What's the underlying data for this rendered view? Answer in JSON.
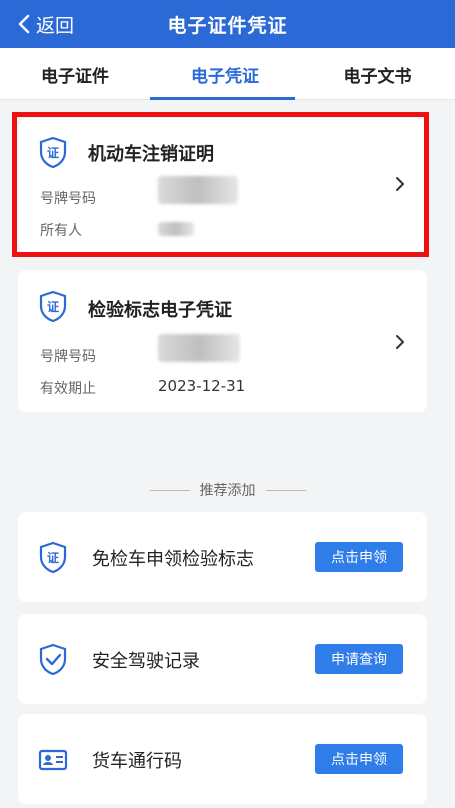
{
  "header": {
    "back_label": "返回",
    "title": "电子证件凭证"
  },
  "tabs": [
    {
      "label": "电子证件"
    },
    {
      "label": "电子凭证"
    },
    {
      "label": "电子文书"
    }
  ],
  "cards": [
    {
      "title": "机动车注销证明",
      "rows": [
        {
          "label": "号牌号码",
          "value": ""
        },
        {
          "label": "所有人",
          "value": ""
        }
      ]
    },
    {
      "title": "检验标志电子凭证",
      "rows": [
        {
          "label": "号牌号码",
          "value": ""
        },
        {
          "label": "有效期止",
          "value": "2023-12-31"
        }
      ]
    }
  ],
  "recommend": {
    "heading": "推荐添加",
    "items": [
      {
        "title": "免检车申领检验标志",
        "button": "点击申领",
        "icon": "certificate-shield-icon"
      },
      {
        "title": "安全驾驶记录",
        "button": "申请查询",
        "icon": "check-shield-icon"
      },
      {
        "title": "货车通行码",
        "button": "点击申领",
        "icon": "id-card-icon"
      }
    ]
  },
  "colors": {
    "primary": "#2b6ad6",
    "button": "#2f7de8",
    "highlight": "#ee1111"
  }
}
